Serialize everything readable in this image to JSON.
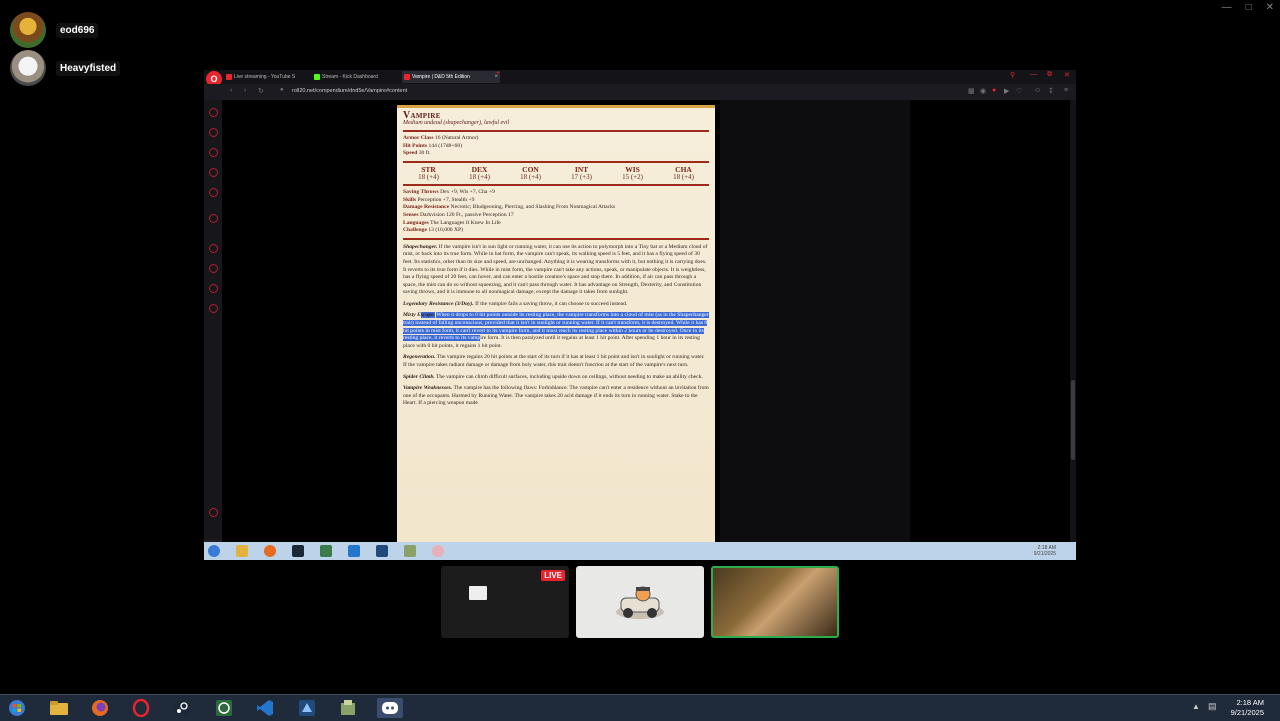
{
  "voice_users": [
    {
      "name": "eod696"
    },
    {
      "name": "Heavyfisted"
    }
  ],
  "browser": {
    "tabs": [
      {
        "label": "Live streaming - YouTube S",
        "color": "#e8242f"
      },
      {
        "label": "Stream - Kick Dashboard",
        "color": "#53fc18"
      },
      {
        "label": "Vampire | D&D 5th Edition",
        "color": "#e8242f"
      }
    ],
    "url": "roll20.net/compendium/dnd5e/Vampire#content"
  },
  "statblock": {
    "name": "Vampire",
    "meta": "Medium undead (shapechanger), lawful evil",
    "armor_class_label": "Armor Class",
    "armor_class": "16 (Natural Armor)",
    "hit_points_label": "Hit Points",
    "hit_points": "144 (17d8+68)",
    "speed_label": "Speed",
    "speed": "30 ft.",
    "abilities": [
      {
        "k": "STR",
        "v": "18 (+4)"
      },
      {
        "k": "DEX",
        "v": "18 (+4)"
      },
      {
        "k": "CON",
        "v": "18 (+4)"
      },
      {
        "k": "INT",
        "v": "17 (+3)"
      },
      {
        "k": "WIS",
        "v": "15 (+2)"
      },
      {
        "k": "CHA",
        "v": "18 (+4)"
      }
    ],
    "saving_throws_label": "Saving Throws",
    "saving_throws": "Dex +9, Wis +7, Cha +9",
    "skills_label": "Skills",
    "skills": "Perception +7, Stealth +9",
    "damage_resistance_label": "Damage Resistance",
    "damage_resistance": "Necrotic; Bludgeoning, Piercing, and Slashing From Nonmagical Attacks",
    "senses_label": "Senses",
    "senses": "Darkvision 120 Ft., passive Perception 17",
    "languages_label": "Languages",
    "languages": "The Languages It Knew In Life",
    "challenge_label": "Challenge",
    "challenge": "13 (10,000 XP)",
    "traits": {
      "shapechanger_name": "Shapechanger.",
      "shapechanger_text": "If the vampire isn't in sun light or running water, it can use its action to polymorph into a Tiny bat or a Medium cloud of mist, or back into its true form. While in bat form, the vampire can't speak, its walking speed is 5 feet, and it has a flying speed of 30 feet. Its statistics, other than its size and speed, are unchanged. Anything it is wearing transforms with it, but nothing it is carrying does. It reverts to its true form if it dies. While in mist form, the vampire can't take any actions, speak, or manipulate objects. It is weightless, has a flying speed of 20 feet, can hover, and can enter a hostile creature's space and stop there. In addition, if air can pass through a space, the mist can do so without squeezing, and it can't pass through water. It has advantage on Strength, Dexterity, and Constitution saving throws, and it is immune to all nonmagical damage, except the damage it takes from sunlight.",
      "legendary_name": "Legendary Resistance (3/Day).",
      "legendary_text": "If the vampire fails a saving throw, it can choose to succeed instead.",
      "misty_name_a": "Misty E",
      "misty_name_b": "scape.",
      "misty_text_hl": "When it drops to 0 hit points outside its resting place, the vampire transforms into a cloud of mist (as in the Shapechanger trait) instead of falling unconscious, provided that it isn't in sunlight or running water. If it can't transform, it is destroyed. While it has 0 hit points in mist form, it can't revert to its vampire form, and it must reach its resting place within 2 hours or be destroyed. Once in its resting place, it reverts to its vamp",
      "misty_text_rest": "ire form. It is then paralyzed until it regains at least 1 hit point. After spending 1 hour in its resting place with 0 hit points, it regains 1 hit point.",
      "regen_name": "Regeneration.",
      "regen_text": "The vampire regains 20 hit points at the start of its turn if it has at least 1 hit point and isn't in sunlight or running water. If the vampire takes radiant damage or damage from holy water, this trait doesn't function at the start of the vampire's next turn.",
      "spider_name": "Spider Climb.",
      "spider_text": "The vampire can climb difficult surfaces, including upside down on ceilings, without needing to make an ability check.",
      "weak_name": "Vampire Weaknesses.",
      "weak_text": "The vampire has the following flaws: Forbiddance. The vampire can't enter a residence without an invitation from one of the occupants. Harmed by Running Water. The vampire takes 20 acid damage if it ends its turn in running water. Stake to the Heart. If a piercing weapon made"
    }
  },
  "inner_clock": {
    "time": "2:18 AM",
    "date": "9/21/2025"
  },
  "stream": {
    "live_label": "LIVE"
  },
  "taskbar_clock": {
    "time": "2:18 AM",
    "date": "9/21/2025"
  },
  "colors": {
    "accent": "#e8242f",
    "highlight": "#3d6ad6",
    "statblock_red": "#9c2b1b"
  }
}
